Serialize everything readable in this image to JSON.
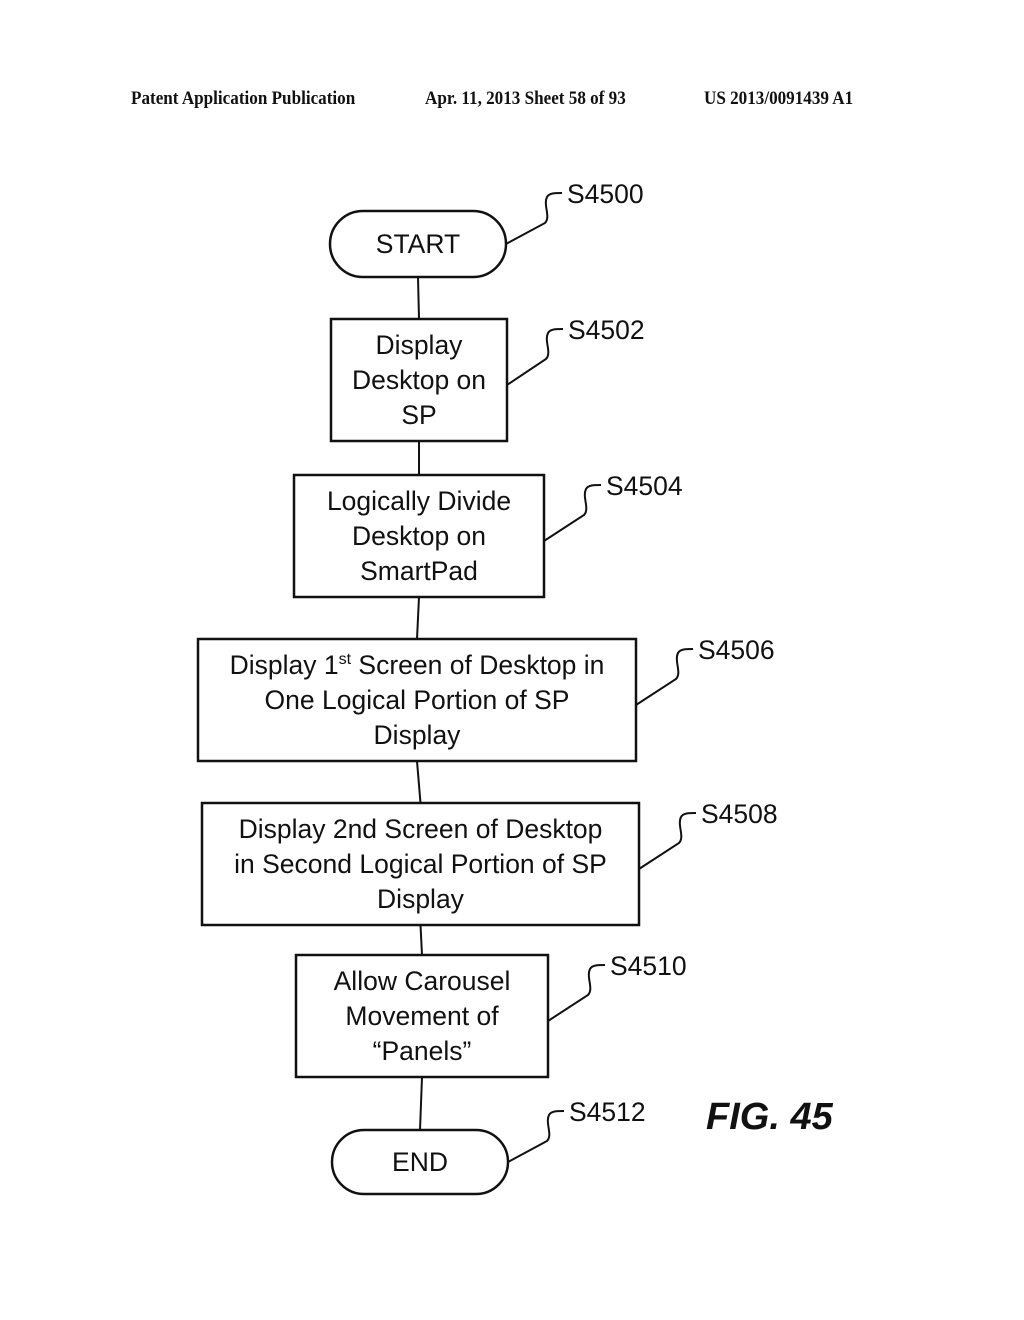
{
  "header": {
    "publication_type": "Patent Application Publication",
    "date_sheet": "Apr. 11, 2013  Sheet 58 of 93",
    "patent_number": "US 2013/0091439 A1"
  },
  "figure_label": "FIG. 45",
  "flowchart": {
    "nodes": [
      {
        "id": "S4500",
        "shape": "terminal",
        "lines": [
          "START"
        ],
        "ref": "S4500"
      },
      {
        "id": "S4502",
        "shape": "process",
        "lines": [
          "Display",
          "Desktop on",
          "SP"
        ],
        "ref": "S4502"
      },
      {
        "id": "S4504",
        "shape": "process",
        "lines": [
          "Logically Divide",
          "Desktop on",
          "SmartPad"
        ],
        "ref": "S4504"
      },
      {
        "id": "S4506",
        "shape": "process",
        "lines": [
          "Display 1|st| Screen of Desktop in",
          "One Logical Portion of SP",
          "Display"
        ],
        "ref": "S4506"
      },
      {
        "id": "S4508",
        "shape": "process",
        "lines": [
          "Display 2nd Screen of Desktop",
          "in Second Logical Portion of SP",
          "Display"
        ],
        "ref": "S4508"
      },
      {
        "id": "S4510",
        "shape": "process",
        "lines": [
          "Allow Carousel",
          "Movement of",
          "“Panels”"
        ],
        "ref": "S4510"
      },
      {
        "id": "S4512",
        "shape": "terminal",
        "lines": [
          "END"
        ],
        "ref": "S4512"
      }
    ],
    "edges": [
      [
        "S4500",
        "S4502"
      ],
      [
        "S4502",
        "S4504"
      ],
      [
        "S4504",
        "S4506"
      ],
      [
        "S4506",
        "S4508"
      ],
      [
        "S4508",
        "S4510"
      ],
      [
        "S4510",
        "S4512"
      ]
    ]
  }
}
